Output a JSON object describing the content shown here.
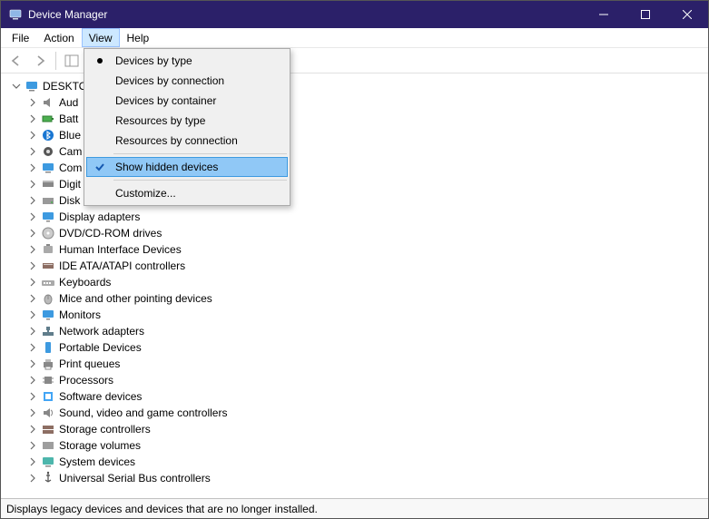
{
  "window": {
    "title": "Device Manager"
  },
  "menubar": {
    "items": [
      "File",
      "Action",
      "View",
      "Help"
    ],
    "open_index": 2
  },
  "dropdown": {
    "items": [
      {
        "label": "Devices by type",
        "marker": "radio",
        "highlight": false
      },
      {
        "label": "Devices by connection",
        "marker": "",
        "highlight": false
      },
      {
        "label": "Devices by container",
        "marker": "",
        "highlight": false
      },
      {
        "label": "Resources by type",
        "marker": "",
        "highlight": false
      },
      {
        "label": "Resources by connection",
        "marker": "",
        "highlight": false
      },
      {
        "sep": true
      },
      {
        "label": "Show hidden devices",
        "marker": "check",
        "highlight": true
      },
      {
        "sep": true
      },
      {
        "label": "Customize...",
        "marker": "",
        "highlight": false
      }
    ]
  },
  "tree": {
    "root": {
      "label": "DESKTO",
      "icon": "computer-icon",
      "expanded": true
    },
    "children": [
      {
        "label": "Aud",
        "icon": "audio-icon"
      },
      {
        "label": "Batt",
        "icon": "battery-icon"
      },
      {
        "label": "Blue",
        "icon": "bluetooth-icon"
      },
      {
        "label": "Cam",
        "icon": "camera-icon"
      },
      {
        "label": "Com",
        "icon": "computer-icon"
      },
      {
        "label": "Digit",
        "icon": "media-icon"
      },
      {
        "label": "Disk",
        "icon": "disk-icon"
      },
      {
        "label": "Display adapters",
        "icon": "display-icon"
      },
      {
        "label": "DVD/CD-ROM drives",
        "icon": "dvd-icon"
      },
      {
        "label": "Human Interface Devices",
        "icon": "hid-icon"
      },
      {
        "label": "IDE ATA/ATAPI controllers",
        "icon": "ide-icon"
      },
      {
        "label": "Keyboards",
        "icon": "keyboard-icon"
      },
      {
        "label": "Mice and other pointing devices",
        "icon": "mouse-icon"
      },
      {
        "label": "Monitors",
        "icon": "display-icon"
      },
      {
        "label": "Network adapters",
        "icon": "network-icon"
      },
      {
        "label": "Portable Devices",
        "icon": "portable-icon"
      },
      {
        "label": "Print queues",
        "icon": "printer-icon"
      },
      {
        "label": "Processors",
        "icon": "cpu-icon"
      },
      {
        "label": "Software devices",
        "icon": "software-icon"
      },
      {
        "label": "Sound, video and game controllers",
        "icon": "sound-icon"
      },
      {
        "label": "Storage controllers",
        "icon": "storage-icon"
      },
      {
        "label": "Storage volumes",
        "icon": "volume-icon"
      },
      {
        "label": "System devices",
        "icon": "system-icon"
      },
      {
        "label": "Universal Serial Bus controllers",
        "icon": "usb-icon"
      }
    ]
  },
  "statusbar": {
    "text": "Displays legacy devices and devices that are no longer installed."
  }
}
